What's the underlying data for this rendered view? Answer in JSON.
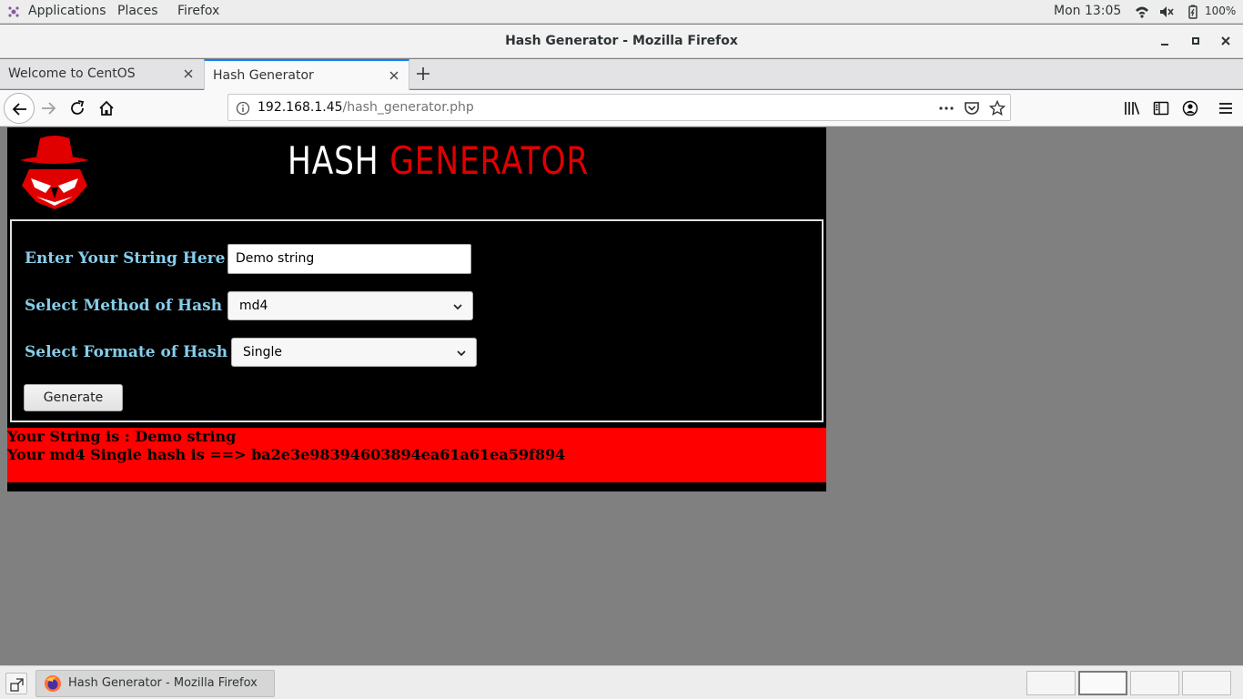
{
  "topbar": {
    "menus": [
      "Applications",
      "Places",
      "Firefox"
    ],
    "clock": "Mon 13:05",
    "battery": "100%"
  },
  "window": {
    "title": "Hash Generator - Mozilla Firefox"
  },
  "tabs": [
    {
      "label": "Welcome to CentOS",
      "active": false
    },
    {
      "label": "Hash Generator",
      "active": true
    }
  ],
  "urlbar": {
    "host": "192.168.1.45",
    "path": "/hash_generator.php"
  },
  "page": {
    "banner_white": "HASH",
    "banner_red": "GENERATOR",
    "string_label": "Enter Your String Here :",
    "string_value": "Demo string",
    "method_label": "Select Method of Hash :",
    "method_value": "md4",
    "format_label": "Select Formate of Hash :",
    "format_value": "Single",
    "generate_label": "Generate",
    "result_line1": "Your String is : Demo string",
    "result_line2": "Your md4 Single hash is ==> ba2e3e98394603894ea61a61ea59f894"
  },
  "taskbar": {
    "task_label": "Hash Generator - Mozilla Firefox",
    "workspaces": 4,
    "active_workspace": 2
  },
  "colors": {
    "label_blue": "#87ceeb",
    "banner_red": "#e00000",
    "result_bg": "#ff0000",
    "tab_accent": "#0a84ff"
  }
}
